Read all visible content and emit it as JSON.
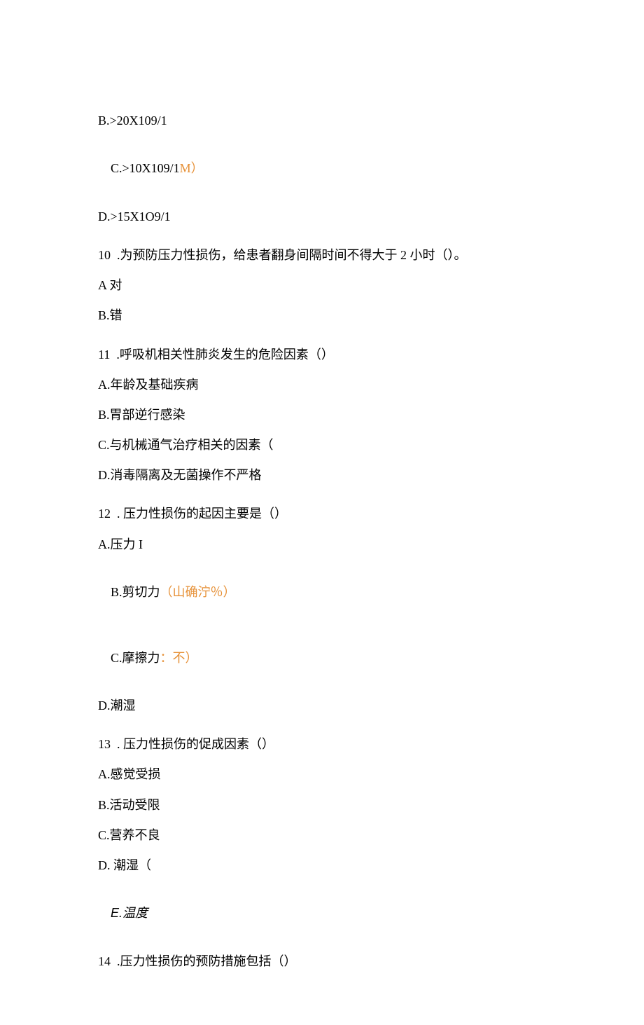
{
  "q9": {
    "optB": "B.>20X109/1",
    "optC_a": "C.>10X109/1",
    "optC_b": "M）",
    "optD": "D.>15X1O9/1"
  },
  "q10": {
    "stem": "10  .为预防压力性损伤，给患者翻身间隔时间不得大于 2 小时（）。",
    "optA": "A 对",
    "optB": "B.错"
  },
  "q11": {
    "stem": "11  .呼吸机相关性肺炎发生的危险因素（）",
    "optA": "A.年龄及基础疾病",
    "optB": "B.胃部逆行感染",
    "optC": "C.与机械通气治疗相关的因素（",
    "optD": "D.消毒隔离及无菌操作不严格"
  },
  "q12": {
    "stem": "12  . 压力性损伤的起因主要是（）",
    "optA": "A.压力 I",
    "optB_a": "B.剪切力",
    "optB_b": "（山确泞％）",
    "optC_a": "C.摩擦力",
    "optC_b": "：不）",
    "optD": "D.潮湿"
  },
  "q13": {
    "stem": "13  . 压力性损伤的促成因素（）",
    "optA": "A.感觉受损",
    "optB": "B.活动受限",
    "optC": "C.营养不良",
    "optD": "D. 潮湿（",
    "optE_a": "E.",
    "optE_b": "温度"
  },
  "q14": {
    "stem": "14  .压力性损伤的预防措施包括（）"
  }
}
